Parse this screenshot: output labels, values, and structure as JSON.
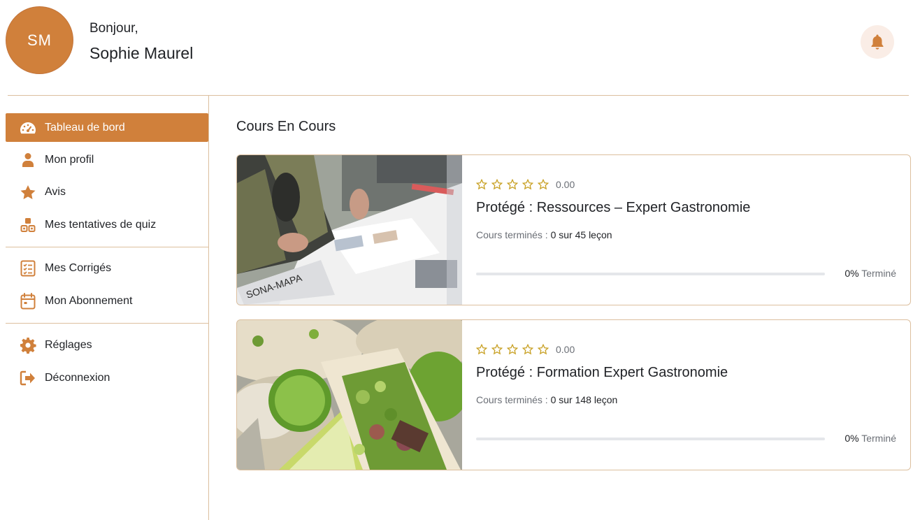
{
  "header": {
    "avatar_initials": "SM",
    "greeting": "Bonjour,",
    "user_name": "Sophie Maurel",
    "bell_icon": "bell-icon"
  },
  "sidebar": {
    "items": [
      {
        "label": "Tableau de bord",
        "icon": "dashboard-icon",
        "active": true
      },
      {
        "label": "Mon profil",
        "icon": "user-icon"
      },
      {
        "label": "Avis",
        "icon": "star-icon"
      },
      {
        "label": "Mes tentatives de quiz",
        "icon": "quiz-icon"
      },
      {
        "label": "Mes Corrigés",
        "icon": "checklist-icon"
      },
      {
        "label": "Mon Abonnement",
        "icon": "calendar-icon"
      },
      {
        "label": "Réglages",
        "icon": "gear-icon"
      },
      {
        "label": "Déconnexion",
        "icon": "logout-icon"
      }
    ]
  },
  "main": {
    "section_title": "Cours En Cours",
    "courses": [
      {
        "rating": "0.00",
        "title": "Protégé : Ressources – Expert Gastronomie",
        "lessons_label": "Cours terminés :",
        "lessons_value": "0 sur 45 leçon",
        "progress": 0,
        "percent_value": "0%",
        "percent_label": "Terminé",
        "image": "magazine-photo"
      },
      {
        "rating": "0.00",
        "title": "Protégé : Formation Expert Gastronomie",
        "lessons_label": "Cours terminés :",
        "lessons_value": "0 sur 148 leçon",
        "progress": 0,
        "percent_value": "0%",
        "percent_label": "Terminé",
        "image": "tacos-photo"
      }
    ]
  },
  "colors": {
    "accent": "#d0803b",
    "border": "#dcbf9e",
    "star": "#c9a227"
  }
}
